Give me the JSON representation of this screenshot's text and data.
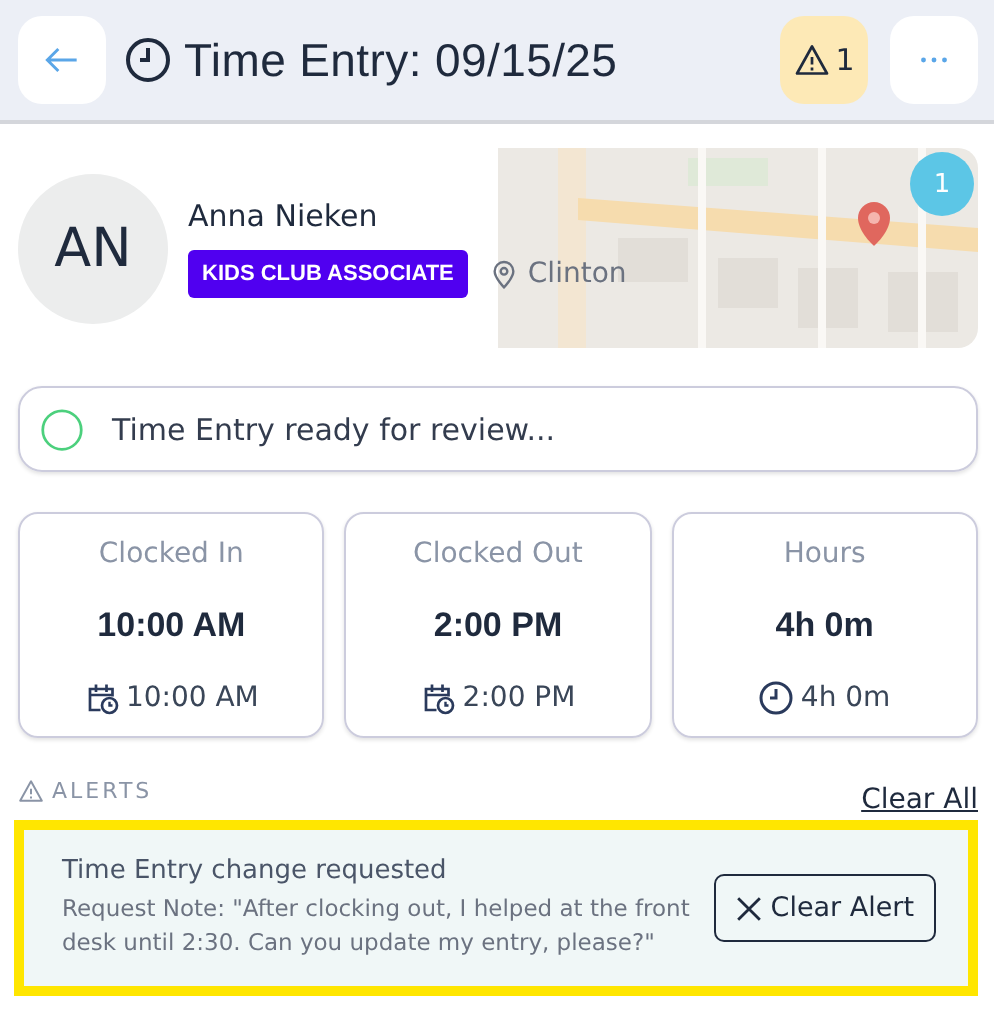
{
  "header": {
    "title": "Time Entry: 09/15/25",
    "alert_count": "1"
  },
  "profile": {
    "initials": "AN",
    "name": "Anna Nieken",
    "role": "KIDS CLUB ASSOCIATE",
    "location": "Clinton",
    "map": {
      "kind": "picture",
      "marker_count": "1"
    }
  },
  "status": {
    "text": "Time Entry ready for review..."
  },
  "stats": [
    {
      "label": "Clocked In",
      "value": "10:00 AM",
      "detail": "10:00 AM",
      "kind": "date"
    },
    {
      "label": "Clocked Out",
      "value": "2:00 PM",
      "detail": "2:00 PM",
      "kind": "date"
    },
    {
      "label": "Hours",
      "value": "4h 0m",
      "detail": "4h 0m",
      "kind": "duration"
    }
  ],
  "alerts": {
    "heading": "ALERTS",
    "clear_all": "Clear All",
    "items": [
      {
        "title": "Time Entry change requested",
        "note": "Request Note: \"After clocking out, I helped at the front desk until 2:30. Can you update my entry, please?\"",
        "button": "Clear Alert",
        "highlighted": true
      }
    ]
  }
}
